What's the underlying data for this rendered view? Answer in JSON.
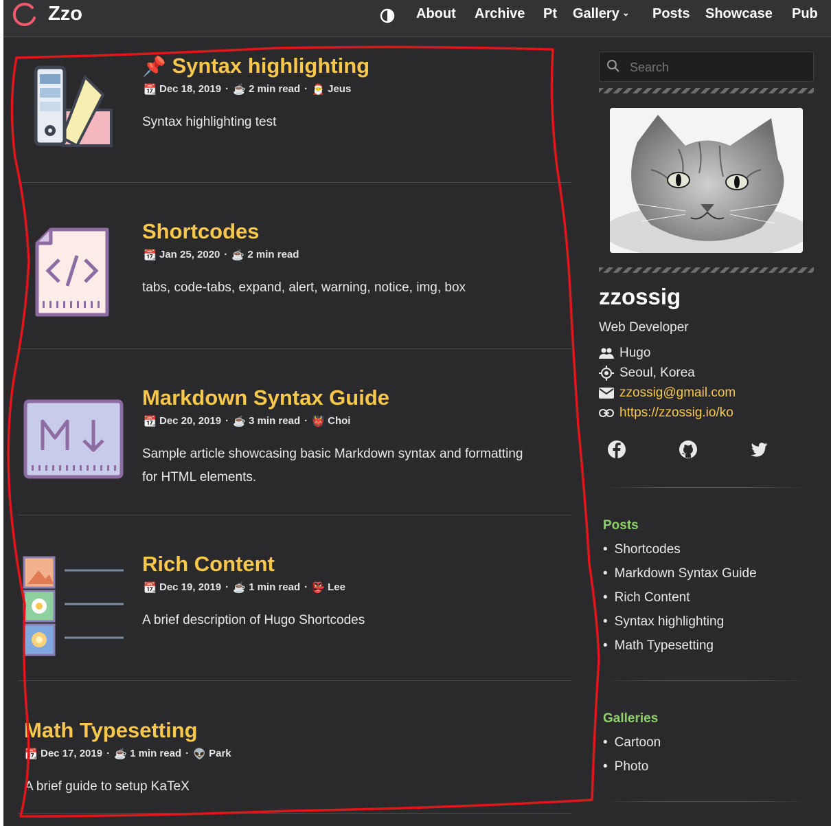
{
  "app": {
    "brand": "Zzo"
  },
  "nav": {
    "items": [
      "About",
      "Archive",
      "Pt",
      "Gallery",
      "Posts",
      "Showcase",
      "Pub"
    ]
  },
  "posts": [
    {
      "title_prefix_icon": "pushpin-icon",
      "title": "Syntax highlighting",
      "date": "Dec 18, 2019",
      "read": "2 min read",
      "author": "Jeus",
      "author_icon": "santa-icon",
      "desc": "Syntax highlighting test",
      "thumb": "swatch-icon"
    },
    {
      "title": "Shortcodes",
      "date": "Jan 25, 2020",
      "read": "2 min read",
      "author": "",
      "desc": "tabs, code-tabs, expand, alert, warning, notice, img, box",
      "thumb": "code-file-icon"
    },
    {
      "title": "Markdown Syntax Guide",
      "date": "Dec 20, 2019",
      "read": "3 min read",
      "author": "Choi",
      "author_icon": "skull-icon",
      "desc": "Sample article showcasing basic Markdown syntax and formatting for HTML elements.",
      "thumb": "markdown-icon"
    },
    {
      "title": "Rich Content",
      "date": "Dec 19, 2019",
      "read": "1 min read",
      "author": "Lee",
      "author_icon": "ogre-icon",
      "desc": "A brief description of Hugo Shortcodes",
      "thumb": "gallery-list-icon"
    },
    {
      "title": "Math Typesetting",
      "date": "Dec 17, 2019",
      "read": "1 min read",
      "author": "Park",
      "author_icon": "alien-icon",
      "desc": "A brief guide to setup KaTeX"
    }
  ],
  "sidebar": {
    "search_placeholder": "Search",
    "name": "zzossig",
    "role": "Web Developer",
    "org": "Hugo",
    "location": "Seoul, Korea",
    "email": "zzossig@gmail.com",
    "website": "https://zzossig.io/ko",
    "social": [
      "facebook-icon",
      "github-icon",
      "twitter-icon"
    ],
    "posts_heading": "Posts",
    "posts_list": [
      "Shortcodes",
      "Markdown Syntax Guide",
      "Rich Content",
      "Syntax highlighting",
      "Math Typesetting"
    ],
    "galleries_heading": "Galleries",
    "galleries_list": [
      "Cartoon",
      "Photo"
    ]
  },
  "colors": {
    "accent": "#f7c84c",
    "heading_green": "#8fd16a",
    "background": "#2a292b",
    "annotation": "#e0161b"
  }
}
